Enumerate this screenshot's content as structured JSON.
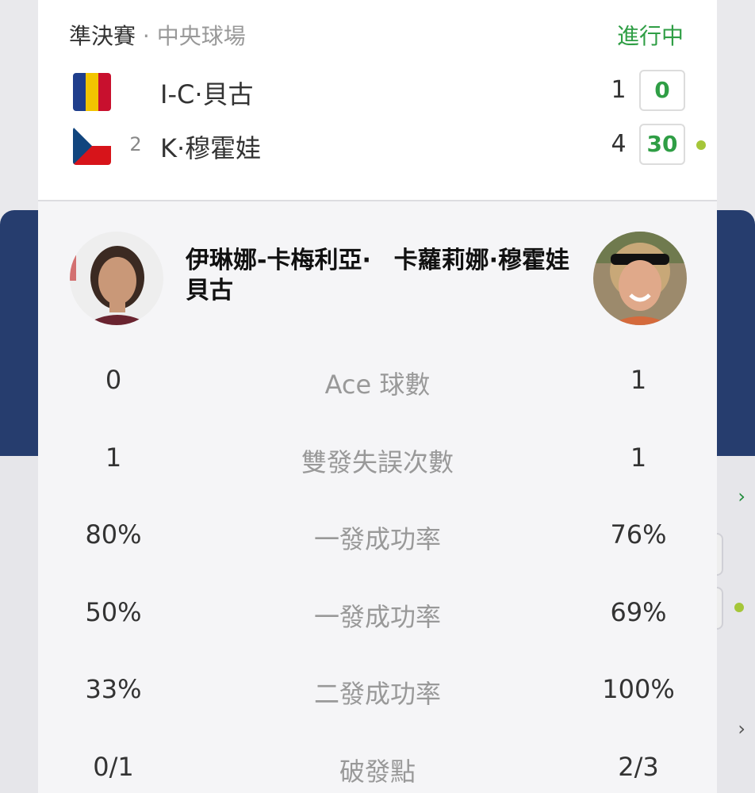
{
  "match": {
    "round": "準決賽",
    "separator": " · ",
    "court": "中央球場",
    "status": "進行中"
  },
  "players": [
    {
      "short_name": "I-C·貝古",
      "seed": "",
      "sets": "1",
      "points": "0",
      "serving": false,
      "flag": "romania-flag"
    },
    {
      "short_name": "K·穆霍娃",
      "seed": "2",
      "sets": "4",
      "points": "30",
      "serving": true,
      "flag": "czech-flag"
    }
  ],
  "full_names": {
    "left": "伊琳娜-卡梅利亞·貝古",
    "right": "卡蘿莉娜·穆霍娃"
  },
  "stats": [
    {
      "label": "Ace 球數",
      "left": "0",
      "right": "1"
    },
    {
      "label": "雙發失誤次數",
      "left": "1",
      "right": "1"
    },
    {
      "label": "一發成功率",
      "left": "80%",
      "right": "76%"
    },
    {
      "label": "一發成功率",
      "left": "50%",
      "right": "69%"
    },
    {
      "label": "二發成功率",
      "left": "33%",
      "right": "100%"
    },
    {
      "label": "破發點",
      "left": "0/1",
      "right": "2/3"
    }
  ],
  "colors": {
    "accent_green": "#2f9e45",
    "serve_dot": "#a5c639",
    "background_blue": "#263d6e"
  }
}
